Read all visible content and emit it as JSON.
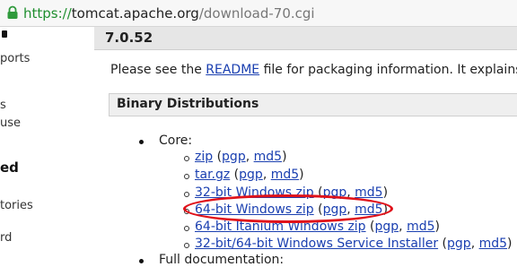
{
  "address_bar": {
    "scheme": "https://",
    "host": "tomcat.apache.org",
    "path": "/download-70.cgi"
  },
  "sidebar": {
    "items": [
      "ports",
      "s",
      "use",
      "ed",
      "tories",
      "rd"
    ]
  },
  "main": {
    "version": "7.0.52",
    "readme": {
      "prefix": "Please see the ",
      "link": "README",
      "suffix": " file for packaging information. It explains w"
    },
    "section_title": "Binary Distributions",
    "core_label": "Core:",
    "core_items": [
      {
        "name": "zip",
        "pgp": "pgp",
        "md5": "md5"
      },
      {
        "name": "tar.gz",
        "pgp": "pgp",
        "md5": "md5"
      },
      {
        "name": "32-bit Windows zip",
        "pgp": "pgp",
        "md5": "md5"
      },
      {
        "name": "64-bit Windows zip",
        "pgp": "pgp",
        "md5": "md5"
      },
      {
        "name": "64-bit Itanium Windows zip",
        "pgp": "pgp",
        "md5": "md5"
      },
      {
        "name": "32-bit/64-bit Windows Service Installer",
        "pgp": "pgp",
        "md5": "md5"
      }
    ],
    "full_doc_label": "Full documentation:",
    "punct": {
      "open": " (",
      "sep": ", ",
      "close": ")"
    }
  },
  "annotation": {
    "color": "#e0121a",
    "highlighted_item": "64-bit Windows zip"
  },
  "colors": {
    "link": "#1a3fb0",
    "scheme": "#1f8f2f"
  }
}
